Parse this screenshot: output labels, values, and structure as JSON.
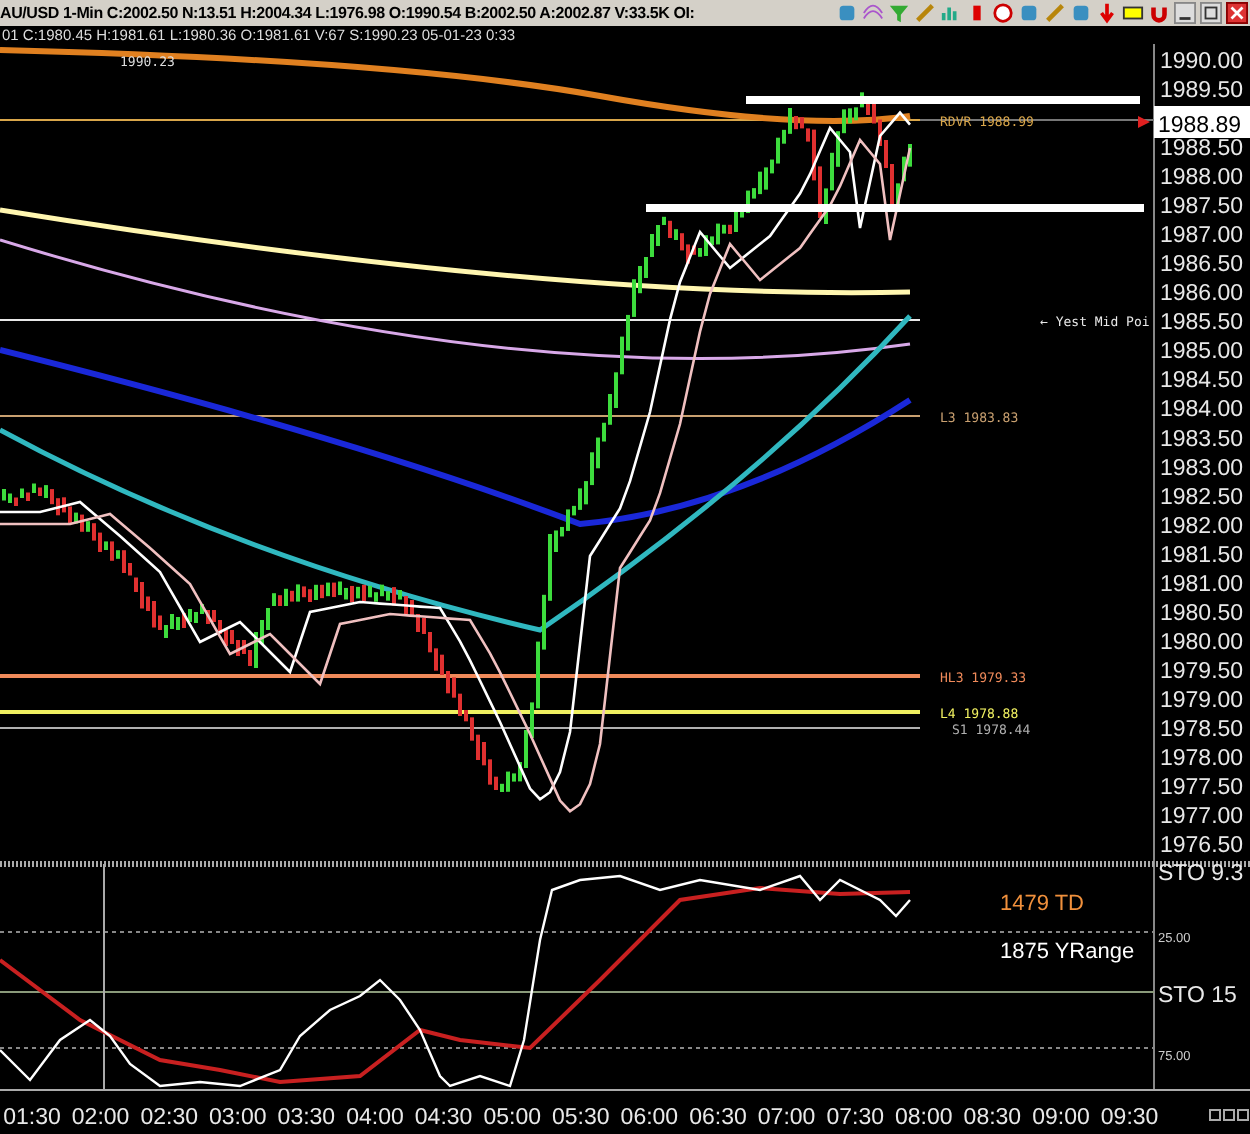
{
  "toolbar": {
    "quote": "AU/USD  1-Min  C:2002.50  N:13.51  H:2004.34  L:1976.98  O:1990.54  B:2002.50  A:2002.87  V:33.5K  OI:"
  },
  "info_line": "01  C:1980.45  H:1981.61  L:1980.36  O:1981.61  V:67  S:1990.23  05-01-23  0:33",
  "price_chart": {
    "note": "1990.23",
    "price_axis": [
      "1990.00",
      "1989.50",
      "1988.50",
      "1988.00",
      "1987.50",
      "1987.00",
      "1986.50",
      "1986.00",
      "1985.50",
      "1985.00",
      "1984.50",
      "1984.00",
      "1983.50",
      "1983.00",
      "1982.50",
      "1982.00",
      "1981.50",
      "1981.00",
      "1980.50",
      "1980.00",
      "1979.50",
      "1979.00",
      "1978.50",
      "1978.00",
      "1977.50",
      "1977.00",
      "1976.50"
    ],
    "current_price": "1988.89",
    "levels": [
      {
        "label": "RDVR 1988.99",
        "color": "#d9a64a"
      },
      {
        "label": "← Yest Mid Poi",
        "color": "#e8e8e8"
      },
      {
        "label": "L3 1983.83",
        "color": "#c9a070"
      },
      {
        "label": "HL3 1979.33",
        "color": "#f08a5a"
      },
      {
        "label": "L4 1978.88",
        "color": "#f0f060"
      },
      {
        "label": "S1 1978.44",
        "color": "#b0b0b0"
      }
    ]
  },
  "oscillator": {
    "axis": [
      "STO 9.3",
      "25.00",
      "STO 15",
      "75.00"
    ],
    "readings": [
      {
        "text": "1479 TD",
        "color": "#f0903c"
      },
      {
        "text": "1875 YRange",
        "color": "#ffffff"
      }
    ]
  },
  "time_axis": [
    "01:30",
    "02:00",
    "02:30",
    "03:00",
    "03:30",
    "04:00",
    "04:30",
    "05:00",
    "05:30",
    "06:00",
    "06:30",
    "07:00",
    "07:30",
    "08:00",
    "08:30",
    "09:00",
    "09:30"
  ]
}
